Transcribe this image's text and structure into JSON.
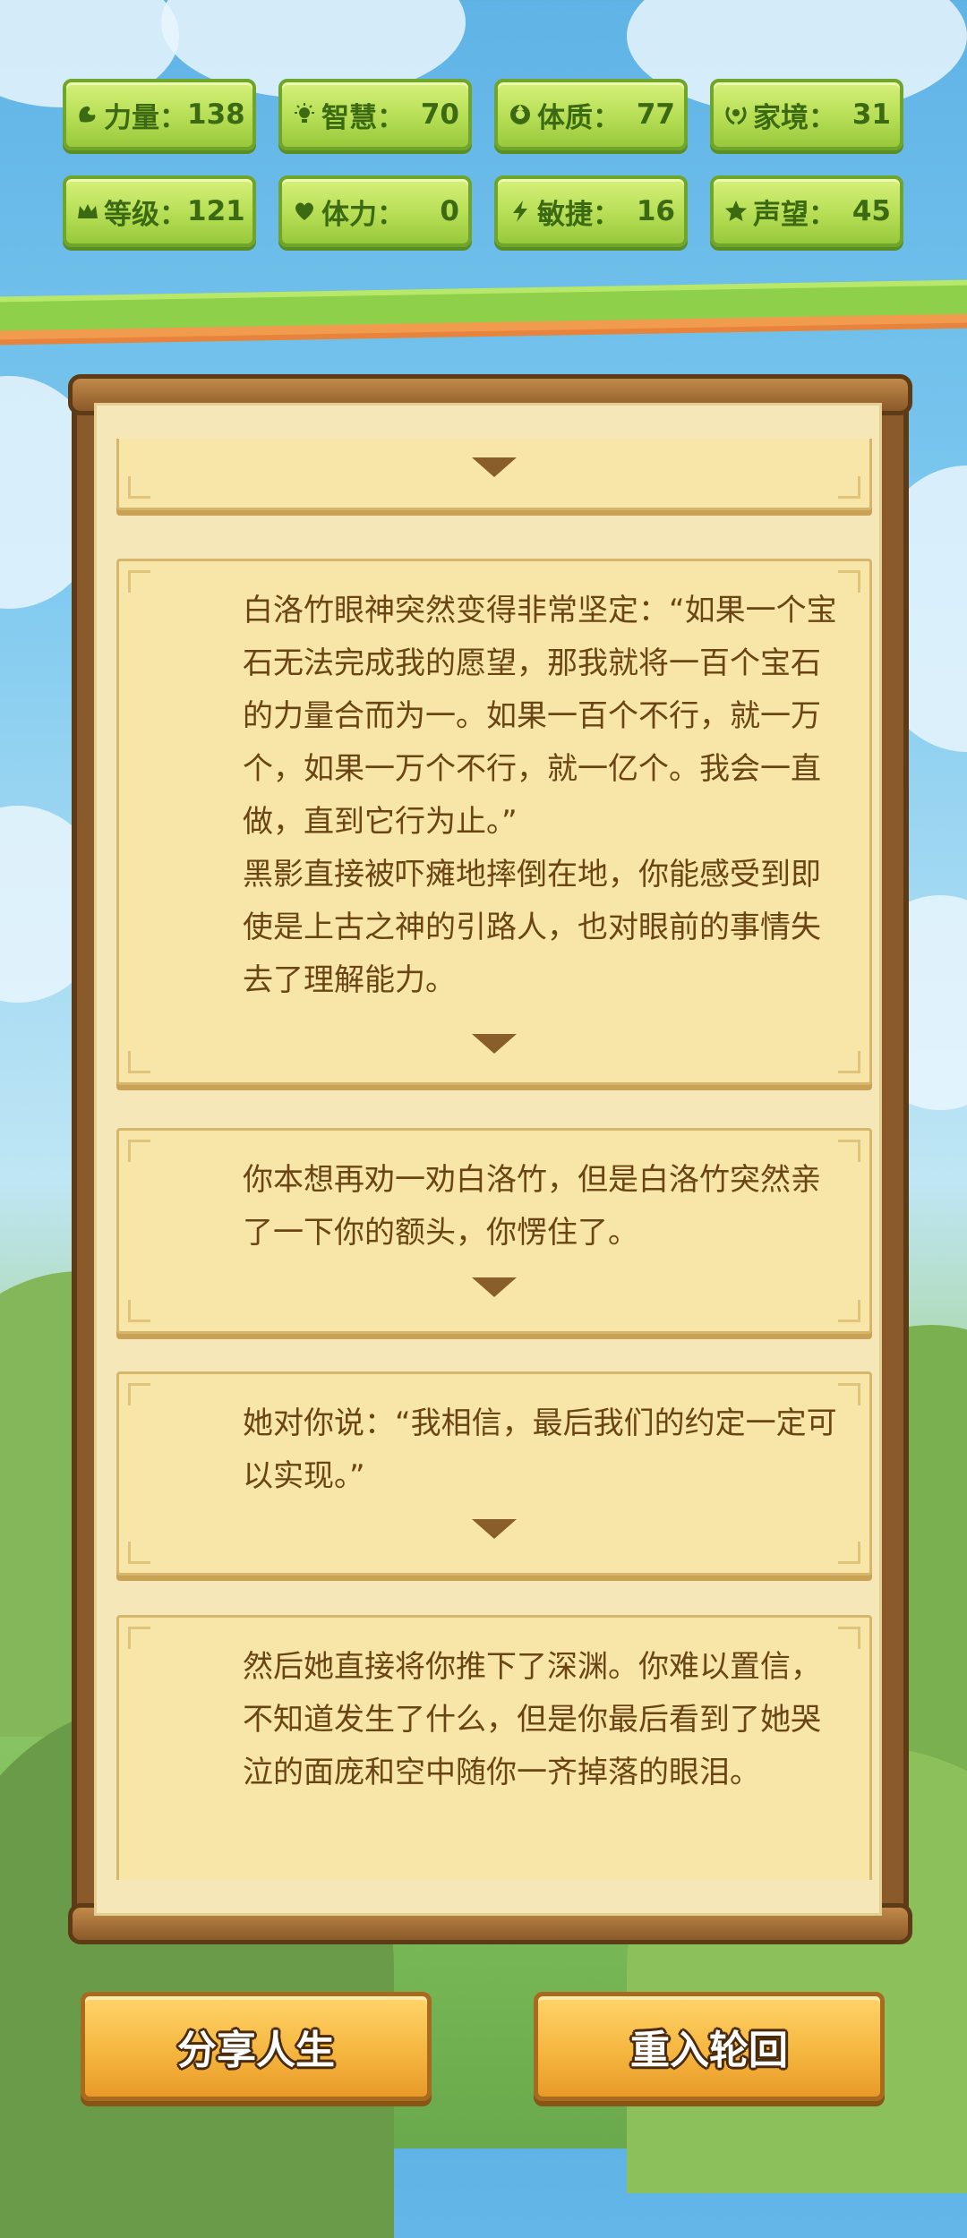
{
  "stats": {
    "strength": {
      "label": "力量：",
      "value": "138",
      "icon": "arm-icon"
    },
    "wisdom": {
      "label": "智慧：",
      "value": "70",
      "icon": "bulb-icon"
    },
    "physique": {
      "label": "体质：",
      "value": "77",
      "icon": "cycle-icon"
    },
    "family": {
      "label": "家境：",
      "value": "31",
      "icon": "laurel-icon"
    },
    "level": {
      "label": "等级：",
      "value": "121",
      "icon": "crown-icon"
    },
    "stamina": {
      "label": "体力：",
      "value": "0",
      "icon": "heart-icon"
    },
    "agility": {
      "label": "敏捷：",
      "value": "16",
      "icon": "lightning-icon"
    },
    "reputation": {
      "label": "声望：",
      "value": "45",
      "icon": "star-icon"
    }
  },
  "story": [
    {
      "text": ""
    },
    {
      "text": "白洛竹眼神突然变得非常坚定：“如果一个宝石无法完成我的愿望，那我就将一百个宝石的力量合而为一。如果一百个不行，就一万个，如果一万个不行，就一亿个。我会一直做，直到它行为止。”\n黑影直接被吓瘫地摔倒在地，你能感受到即使是上古之神的引路人，也对眼前的事情失去了理解能力。"
    },
    {
      "text": "你本想再劝一劝白洛竹，但是白洛竹突然亲了一下你的额头，你愣住了。"
    },
    {
      "text": "她对你说：“我相信，最后我们的约定一定可以实现。”"
    },
    {
      "text": "然后她直接将你推下了深渊。你难以置信，不知道发生了什么，但是你最后看到了她哭泣的面庞和空中随你一齐掉落的眼泪。"
    }
  ],
  "buttons": {
    "share": "分享人生",
    "restart": "重入轮回"
  }
}
